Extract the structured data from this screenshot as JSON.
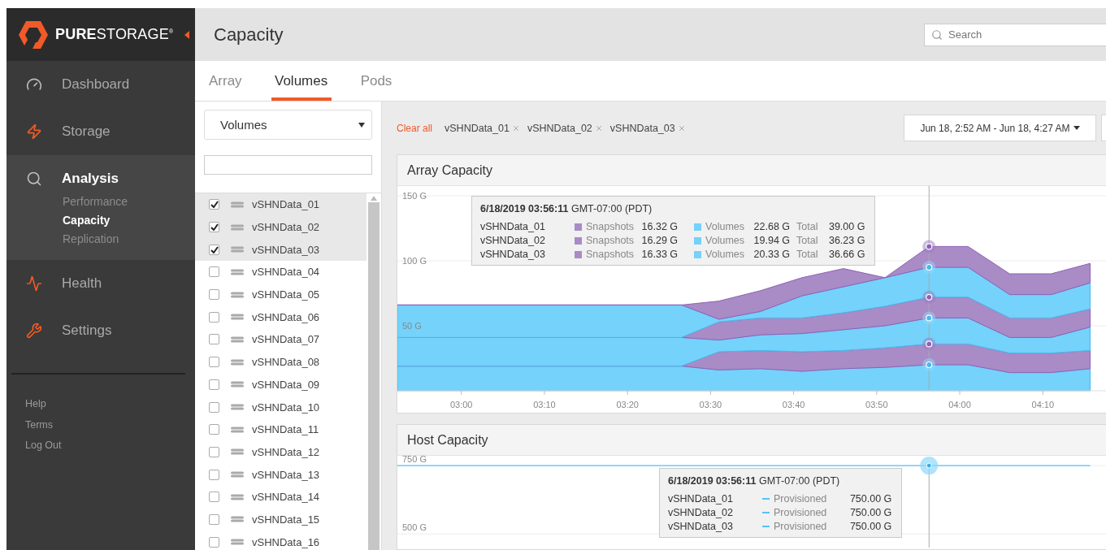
{
  "logo": "**PURE**STORAGE$^{®}$",
  "nav": [
    {
      "label": "Dashboard",
      "selected": false
    },
    {
      "label": "Storage",
      "selected": false
    },
    {
      "label": "Analysis",
      "selected": true,
      "children": [
        {
          "label": "Performance",
          "selected": false
        },
        {
          "label": "Capacity",
          "selected": true
        },
        {
          "label": "Replication",
          "selected": false
        }
      ]
    },
    {
      "label": "Health",
      "selected": false
    },
    {
      "label": "Settings",
      "selected": false
    }
  ],
  "footer_links": [
    "Help",
    "Terms",
    "Log Out"
  ],
  "header": {
    "title": "Capacity",
    "search": {
      "placeholder": "Search"
    }
  },
  "tabs": [
    {
      "label": "Array",
      "selected": false
    },
    {
      "label": "Volumes",
      "selected": true
    },
    {
      "label": "Pods",
      "selected": false
    }
  ],
  "volume_panel": {
    "type_select": "Volumes",
    "volumes": [
      {
        "name": "vSHNData_01",
        "checked": true
      },
      {
        "name": "vSHNData_02",
        "checked": true
      },
      {
        "name": "vSHNData_03",
        "checked": true
      },
      {
        "name": "vSHNData_04",
        "checked": false
      },
      {
        "name": "vSHNData_05",
        "checked": false
      },
      {
        "name": "vSHNData_06",
        "checked": false
      },
      {
        "name": "vSHNData_07",
        "checked": false
      },
      {
        "name": "vSHNData_08",
        "checked": false
      },
      {
        "name": "vSHNData_09",
        "checked": false
      },
      {
        "name": "vSHNData_10",
        "checked": false
      },
      {
        "name": "vSHNData_11",
        "checked": false
      },
      {
        "name": "vSHNData_12",
        "checked": false
      },
      {
        "name": "vSHNData_13",
        "checked": false
      },
      {
        "name": "vSHNData_14",
        "checked": false
      },
      {
        "name": "vSHNData_15",
        "checked": false
      },
      {
        "name": "vSHNData_16",
        "checked": false
      }
    ]
  },
  "filters": {
    "clear": "Clear all",
    "chips": [
      "vSHNData_01",
      "vSHNData_02",
      "vSHNData_03"
    ]
  },
  "time_range": "Jun 18, 2:52 AM - Jun 18, 4:27 AM",
  "array_capacity": {
    "title": "Array Capacity",
    "chart_data": {
      "type": "area",
      "stacked": true,
      "grid": true,
      "x": [
        172.3,
        206.5,
        211,
        216,
        221,
        226,
        231,
        236.3,
        241,
        246,
        251,
        255.7
      ],
      "xlim": [
        172.3,
        257.7
      ],
      "ylim": [
        0,
        157.5
      ],
      "xticks": [
        {
          "value": 180,
          "label": "03:00"
        },
        {
          "value": 190,
          "label": "03:10"
        },
        {
          "value": 200,
          "label": "03:20"
        },
        {
          "value": 210,
          "label": "03:30"
        },
        {
          "value": 220,
          "label": "03:40"
        },
        {
          "value": 230,
          "label": "03:50"
        },
        {
          "value": 240,
          "label": "04:00"
        },
        {
          "value": 250,
          "label": "04:10"
        }
      ],
      "yticks": [
        {
          "value": 50,
          "label": "50 G"
        },
        {
          "value": 100,
          "label": "100 G"
        },
        {
          "value": 150,
          "label": "150 G"
        }
      ],
      "series": [
        {
          "color": "#74d2fb",
          "values": [
            19,
            19,
            16,
            17,
            15,
            17,
            18,
            20,
            20,
            14,
            14,
            17
          ]
        },
        {
          "color": "#a98bc6",
          "values": [
            0,
            0,
            14,
            14,
            15,
            14,
            15,
            16,
            16,
            15,
            15,
            14
          ]
        },
        {
          "color": "#74d2fb",
          "values": [
            22,
            22,
            9,
            12,
            14,
            16,
            17,
            20,
            20,
            12,
            12,
            18
          ]
        },
        {
          "color": "#a98bc6",
          "values": [
            0,
            0,
            14,
            13,
            12,
            13,
            15,
            16,
            16,
            15,
            15,
            14
          ]
        },
        {
          "color": "#74d2fb",
          "values": [
            25,
            25,
            2,
            5,
            17,
            20,
            22,
            23,
            23,
            18,
            18,
            20
          ]
        },
        {
          "color": "#a98bc6",
          "values": [
            0,
            0,
            14,
            16,
            14,
            14,
            null,
            16,
            16,
            16,
            16,
            15
          ]
        }
      ],
      "ref_lines": [
        {
          "axis": "x",
          "value": 236.3
        }
      ]
    },
    "tooltip": {
      "time": "**6/18/2019 03:56:11** GMT-07:00 (PDT)",
      "rows": [
        {
          "name": "vSHNData_01",
          "snapshots_label": "Snapshots",
          "snapshots": "16.32 G",
          "volumes_label": "Volumes",
          "volumes": "22.68 G",
          "total_label": "Total",
          "total": "39.00 G"
        },
        {
          "name": "vSHNData_02",
          "snapshots_label": "Snapshots",
          "snapshots": "16.29 G",
          "volumes_label": "Volumes",
          "volumes": "19.94 G",
          "total_label": "Total",
          "total": "36.23 G"
        },
        {
          "name": "vSHNData_03",
          "snapshots_label": "Snapshots",
          "snapshots": "16.33 G",
          "volumes_label": "Volumes",
          "volumes": "20.33 G",
          "total_label": "Total",
          "total": "36.66 G"
        }
      ]
    }
  },
  "host_capacity": {
    "title": "Host Capacity",
    "chart_data": {
      "type": "line",
      "grid": true,
      "x": [
        172.3,
        255.7
      ],
      "xlim": [
        172.3,
        257.7
      ],
      "ylim": [
        450,
        786
      ],
      "ref_lines": [
        {
          "axis": "x",
          "value": 236.3
        }
      ],
      "yticks": [
        {
          "value": 500,
          "label": "500 G"
        },
        {
          "value": 750,
          "label": "750 G"
        }
      ],
      "series": [
        {
          "color": "#55c4f5",
          "values": [
            750,
            750
          ]
        }
      ]
    },
    "tooltip": {
      "time": "**6/18/2019 03:56:11** GMT-07:00 (PDT)",
      "rows": [
        {
          "name": "vSHNData_01",
          "label": "Provisioned",
          "value": "750.00 G"
        },
        {
          "name": "vSHNData_02",
          "label": "Provisioned",
          "value": "750.00 G"
        },
        {
          "name": "vSHNData_03",
          "label": "Provisioned",
          "value": "750.00 G"
        }
      ]
    }
  }
}
